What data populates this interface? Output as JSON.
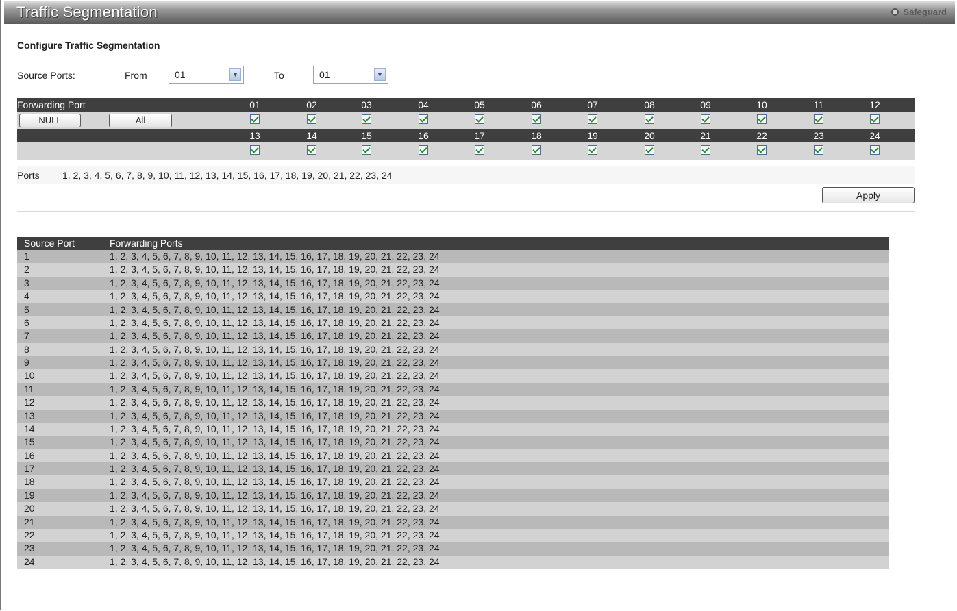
{
  "header": {
    "title": "Traffic Segmentation",
    "safeguard_label": "Safeguard"
  },
  "section_title": "Configure Traffic Segmentation",
  "source_ports": {
    "label": "Source Ports:",
    "from_label": "From",
    "from_value": "01",
    "to_label": "To",
    "to_value": "01"
  },
  "forwarding": {
    "label": "Forwarding Port",
    "null_button": "NULL",
    "all_button": "All",
    "ports_row1": [
      "01",
      "02",
      "03",
      "04",
      "05",
      "06",
      "07",
      "08",
      "09",
      "10",
      "11",
      "12"
    ],
    "ports_row2": [
      "13",
      "14",
      "15",
      "16",
      "17",
      "18",
      "19",
      "20",
      "21",
      "22",
      "23",
      "24"
    ],
    "checked_row1": [
      true,
      true,
      true,
      true,
      true,
      true,
      true,
      true,
      true,
      true,
      true,
      true
    ],
    "checked_row2": [
      true,
      true,
      true,
      true,
      true,
      true,
      true,
      true,
      true,
      true,
      true,
      true
    ]
  },
  "ports_summary": {
    "label": "Ports",
    "value": "1, 2, 3, 4, 5, 6, 7, 8, 9, 10, 11, 12, 13, 14, 15, 16, 17, 18, 19, 20, 21, 22, 23, 24"
  },
  "apply_button": "Apply",
  "table": {
    "headers": [
      "Source Port",
      "Forwarding Ports"
    ],
    "rows": [
      [
        "1",
        "1, 2, 3, 4, 5, 6, 7, 8, 9, 10, 11, 12, 13, 14, 15, 16, 17, 18, 19, 20, 21, 22, 23, 24"
      ],
      [
        "2",
        "1, 2, 3, 4, 5, 6, 7, 8, 9, 10, 11, 12, 13, 14, 15, 16, 17, 18, 19, 20, 21, 22, 23, 24"
      ],
      [
        "3",
        "1, 2, 3, 4, 5, 6, 7, 8, 9, 10, 11, 12, 13, 14, 15, 16, 17, 18, 19, 20, 21, 22, 23, 24"
      ],
      [
        "4",
        "1, 2, 3, 4, 5, 6, 7, 8, 9, 10, 11, 12, 13, 14, 15, 16, 17, 18, 19, 20, 21, 22, 23, 24"
      ],
      [
        "5",
        "1, 2, 3, 4, 5, 6, 7, 8, 9, 10, 11, 12, 13, 14, 15, 16, 17, 18, 19, 20, 21, 22, 23, 24"
      ],
      [
        "6",
        "1, 2, 3, 4, 5, 6, 7, 8, 9, 10, 11, 12, 13, 14, 15, 16, 17, 18, 19, 20, 21, 22, 23, 24"
      ],
      [
        "7",
        "1, 2, 3, 4, 5, 6, 7, 8, 9, 10, 11, 12, 13, 14, 15, 16, 17, 18, 19, 20, 21, 22, 23, 24"
      ],
      [
        "8",
        "1, 2, 3, 4, 5, 6, 7, 8, 9, 10, 11, 12, 13, 14, 15, 16, 17, 18, 19, 20, 21, 22, 23, 24"
      ],
      [
        "9",
        "1, 2, 3, 4, 5, 6, 7, 8, 9, 10, 11, 12, 13, 14, 15, 16, 17, 18, 19, 20, 21, 22, 23, 24"
      ],
      [
        "10",
        "1, 2, 3, 4, 5, 6, 7, 8, 9, 10, 11, 12, 13, 14, 15, 16, 17, 18, 19, 20, 21, 22, 23, 24"
      ],
      [
        "11",
        "1, 2, 3, 4, 5, 6, 7, 8, 9, 10, 11, 12, 13, 14, 15, 16, 17, 18, 19, 20, 21, 22, 23, 24"
      ],
      [
        "12",
        "1, 2, 3, 4, 5, 6, 7, 8, 9, 10, 11, 12, 13, 14, 15, 16, 17, 18, 19, 20, 21, 22, 23, 24"
      ],
      [
        "13",
        "1, 2, 3, 4, 5, 6, 7, 8, 9, 10, 11, 12, 13, 14, 15, 16, 17, 18, 19, 20, 21, 22, 23, 24"
      ],
      [
        "14",
        "1, 2, 3, 4, 5, 6, 7, 8, 9, 10, 11, 12, 13, 14, 15, 16, 17, 18, 19, 20, 21, 22, 23, 24"
      ],
      [
        "15",
        "1, 2, 3, 4, 5, 6, 7, 8, 9, 10, 11, 12, 13, 14, 15, 16, 17, 18, 19, 20, 21, 22, 23, 24"
      ],
      [
        "16",
        "1, 2, 3, 4, 5, 6, 7, 8, 9, 10, 11, 12, 13, 14, 15, 16, 17, 18, 19, 20, 21, 22, 23, 24"
      ],
      [
        "17",
        "1, 2, 3, 4, 5, 6, 7, 8, 9, 10, 11, 12, 13, 14, 15, 16, 17, 18, 19, 20, 21, 22, 23, 24"
      ],
      [
        "18",
        "1, 2, 3, 4, 5, 6, 7, 8, 9, 10, 11, 12, 13, 14, 15, 16, 17, 18, 19, 20, 21, 22, 23, 24"
      ],
      [
        "19",
        "1, 2, 3, 4, 5, 6, 7, 8, 9, 10, 11, 12, 13, 14, 15, 16, 17, 18, 19, 20, 21, 22, 23, 24"
      ],
      [
        "20",
        "1, 2, 3, 4, 5, 6, 7, 8, 9, 10, 11, 12, 13, 14, 15, 16, 17, 18, 19, 20, 21, 22, 23, 24"
      ],
      [
        "21",
        "1, 2, 3, 4, 5, 6, 7, 8, 9, 10, 11, 12, 13, 14, 15, 16, 17, 18, 19, 20, 21, 22, 23, 24"
      ],
      [
        "22",
        "1, 2, 3, 4, 5, 6, 7, 8, 9, 10, 11, 12, 13, 14, 15, 16, 17, 18, 19, 20, 21, 22, 23, 24"
      ],
      [
        "23",
        "1, 2, 3, 4, 5, 6, 7, 8, 9, 10, 11, 12, 13, 14, 15, 16, 17, 18, 19, 20, 21, 22, 23, 24"
      ],
      [
        "24",
        "1, 2, 3, 4, 5, 6, 7, 8, 9, 10, 11, 12, 13, 14, 15, 16, 17, 18, 19, 20, 21, 22, 23, 24"
      ]
    ]
  },
  "colors": {
    "header_dark": "#3f3f3f",
    "row_light": "#d6d6d6",
    "table_odd": "#b9b9b9",
    "table_even": "#d2d2d2",
    "check_green": "#2c8a2c"
  },
  "icons": {
    "safeguard": "radio-circle-icon",
    "dropdown": "chevron-down-icon",
    "checkbox": "checkmark-icon"
  }
}
